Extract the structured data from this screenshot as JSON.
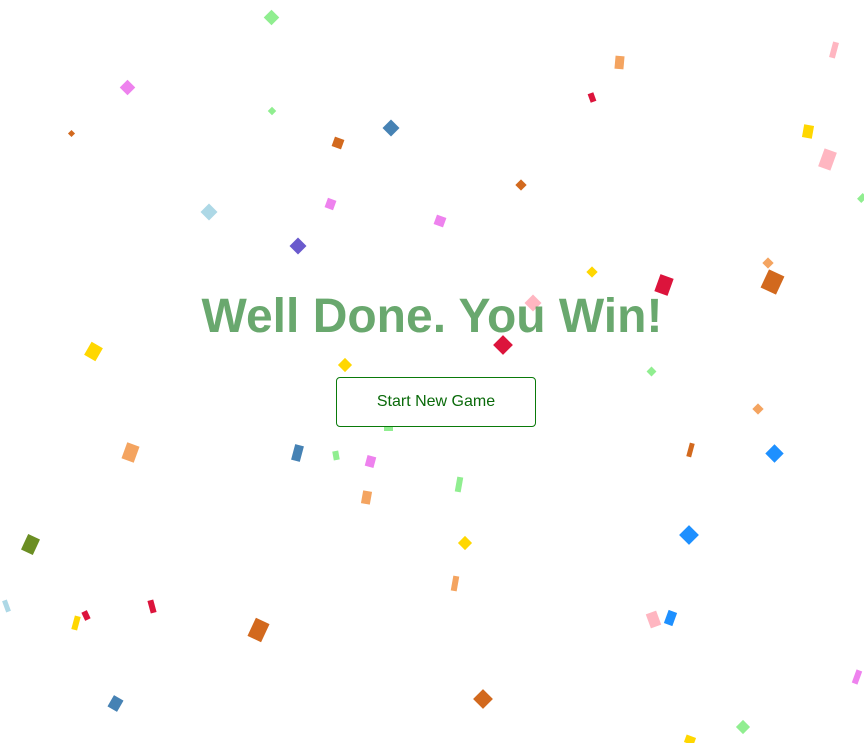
{
  "screen": {
    "headline": "Well Done. You Win!",
    "button_label": "Start New Game"
  },
  "colors": {
    "background": "#ffffff",
    "headline": "#4f9a55",
    "button_text": "#0a6a0a",
    "button_border": "#0a7a0a",
    "confetti_palette": [
      "#90ee90",
      "#ee82ee",
      "#f4a460",
      "#d2691e",
      "#4682b4",
      "#ffd700",
      "#ffb6c1",
      "#dc143c",
      "#6a5acd",
      "#add8e6",
      "#1e90ff",
      "#6b8e23"
    ]
  },
  "confetti": {
    "shape": "rotated-rectangle",
    "piece_count": 58
  }
}
